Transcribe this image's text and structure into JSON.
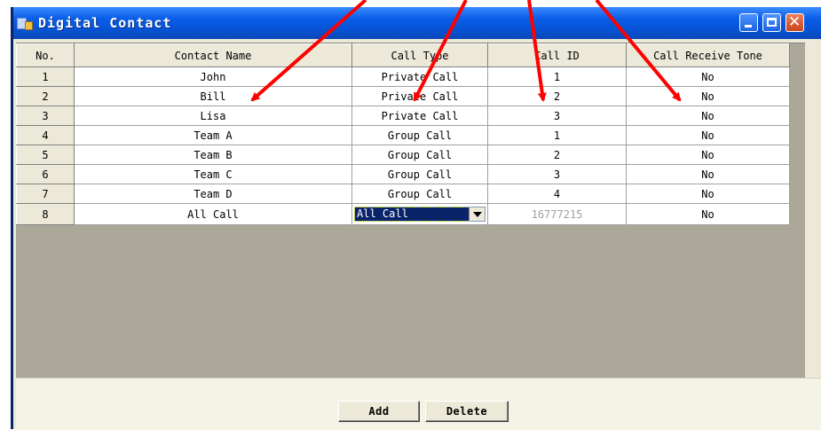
{
  "window": {
    "title": "Digital Contact"
  },
  "table": {
    "columns": [
      "No.",
      "Contact Name",
      "Call Type",
      "Call ID",
      "Call Receive Tone"
    ],
    "rows": [
      {
        "no": "1",
        "name": "John",
        "type": "Private Call",
        "id": "1",
        "tone": "No"
      },
      {
        "no": "2",
        "name": "Bill",
        "type": "Private Call",
        "id": "2",
        "tone": "No"
      },
      {
        "no": "3",
        "name": "Lisa",
        "type": "Private Call",
        "id": "3",
        "tone": "No"
      },
      {
        "no": "4",
        "name": "Team A",
        "type": "Group Call",
        "id": "1",
        "tone": "No"
      },
      {
        "no": "5",
        "name": "Team B",
        "type": "Group Call",
        "id": "2",
        "tone": "No"
      },
      {
        "no": "6",
        "name": "Team C",
        "type": "Group Call",
        "id": "3",
        "tone": "No"
      },
      {
        "no": "7",
        "name": "Team D",
        "type": "Group Call",
        "id": "4",
        "tone": "No"
      }
    ],
    "edit_row": {
      "no": "8",
      "name": "All Call",
      "type_selected": "All Call",
      "id": "16777215",
      "tone": "No"
    }
  },
  "buttons": {
    "add": "Add",
    "delete": "Delete"
  },
  "annotation_color": "#ff0000"
}
